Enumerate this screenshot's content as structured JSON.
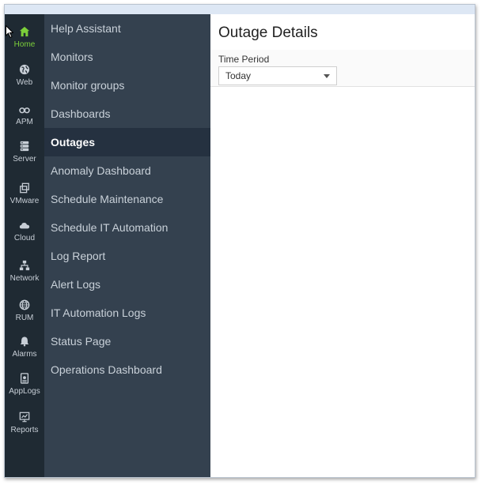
{
  "rail": {
    "items": [
      {
        "label": "Home",
        "icon": "home-icon"
      },
      {
        "label": "Web",
        "icon": "globe-icon"
      },
      {
        "label": "APM",
        "icon": "binoculars-icon"
      },
      {
        "label": "Server",
        "icon": "server-icon"
      },
      {
        "label": "VMware",
        "icon": "vmware-icon"
      },
      {
        "label": "Cloud",
        "icon": "cloud-icon"
      },
      {
        "label": "Network",
        "icon": "network-icon"
      },
      {
        "label": "RUM",
        "icon": "rum-globe-icon"
      },
      {
        "label": "Alarms",
        "icon": "bell-icon"
      },
      {
        "label": "AppLogs",
        "icon": "applogs-icon"
      },
      {
        "label": "Reports",
        "icon": "reports-icon"
      }
    ],
    "active_color": "#7ccf3a"
  },
  "menu": {
    "items": [
      {
        "label": "Help Assistant"
      },
      {
        "label": "Monitors"
      },
      {
        "label": "Monitor groups"
      },
      {
        "label": "Dashboards"
      },
      {
        "label": "Outages"
      },
      {
        "label": "Anomaly Dashboard"
      },
      {
        "label": "Schedule Maintenance"
      },
      {
        "label": "Schedule IT Automation"
      },
      {
        "label": "Log Report"
      },
      {
        "label": "Alert Logs"
      },
      {
        "label": "IT Automation Logs"
      },
      {
        "label": "Status Page"
      },
      {
        "label": "Operations Dashboard"
      }
    ],
    "active": "Outages"
  },
  "main": {
    "title": "Outage Details",
    "filter": {
      "label": "Time Period",
      "selected": "Today"
    }
  },
  "colors": {
    "rail_bg": "#1f2a33",
    "menu_bg": "#34414f",
    "menu_active_bg": "#253140"
  }
}
